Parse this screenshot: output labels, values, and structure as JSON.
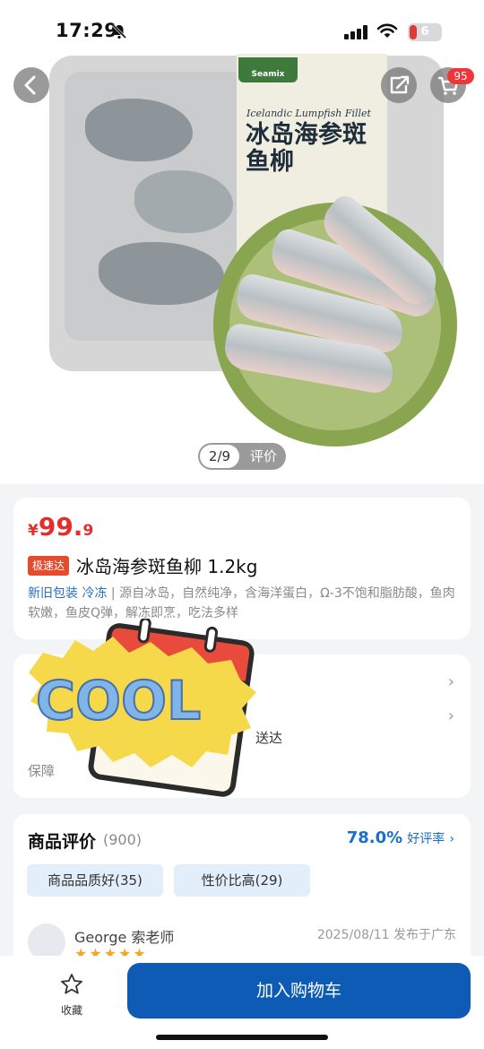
{
  "status_bar": {
    "time": "17:29",
    "battery": "6"
  },
  "header": {
    "cart_badge": "95"
  },
  "gallery": {
    "brand": "Seamix",
    "package_en": "Icelandic Lumpfish Fillet",
    "package_cn": "冰岛海参斑鱼柳",
    "pager": "2/9",
    "review_tab": "评价"
  },
  "product": {
    "price_symbol": "¥",
    "price_int": "99.",
    "price_dec": "9",
    "tag": "极速达",
    "title": "冰岛海参斑鱼柳 1.2kg",
    "desc_tag1": "新旧包装",
    "desc_tag2": "冷冻",
    "desc_text": " | 源自冰岛，自然纯净，含海洋蛋白，Ω-3不饱和脂肪酸，鱼肉软嫩，鱼皮Q弹，解冻即烹，吃法多样"
  },
  "service": {
    "delivery_text": "送达",
    "guarantee_label": "保障",
    "sticker_text": "COOL"
  },
  "reviews": {
    "title": "商品评价",
    "count": "(900)",
    "rate": "78.0%",
    "rate_label": "好评率",
    "chips": [
      "商品品质好(35)",
      "性价比高(29)"
    ],
    "user": "George   索老师",
    "date": "2025/08/11 发布于广东",
    "stars": "★★★★★"
  },
  "bottom": {
    "favorite_label": "收藏",
    "add_to_cart": "加入购物车"
  },
  "colors": {
    "price": "#e62d2d",
    "accent_blue": "#0d5bb5",
    "tag_red": "#e54c2e"
  }
}
